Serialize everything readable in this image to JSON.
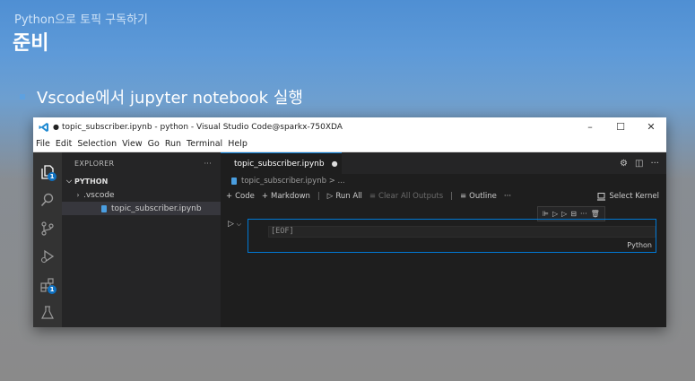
{
  "slide": {
    "subtitle": "Python으로 토픽 구독하기",
    "title": "준비",
    "bullet": "Vscode에서 jupyter notebook 실행"
  },
  "window": {
    "title": "topic_subscriber.ipynb - python - Visual Studio Code@sparkx-750XDA",
    "modified_dot": "●",
    "controls": {
      "minimize": "–",
      "maximize": "☐",
      "close": "✕"
    }
  },
  "menu": [
    "File",
    "Edit",
    "Selection",
    "View",
    "Go",
    "Run",
    "Terminal",
    "Help"
  ],
  "activity_bar": {
    "explorer_badge": "1",
    "extensions_badge": "1",
    "icons": [
      "files-icon",
      "search-icon",
      "source-control-icon",
      "run-debug-icon",
      "extensions-icon",
      "testing-icon"
    ]
  },
  "explorer": {
    "header": "EXPLORER",
    "more": "···",
    "section": "PYTHON",
    "items": [
      {
        "label": ".vscode",
        "type": "folder"
      },
      {
        "label": "topic_subscriber.ipynb",
        "type": "notebook"
      }
    ]
  },
  "editor": {
    "tab": {
      "label": "topic_subscriber.ipynb",
      "dirty": "●"
    },
    "breadcrumb": "topic_subscriber.ipynb > ...",
    "toolbar": {
      "code": "Code",
      "markdown": "Markdown",
      "run_all": "Run All",
      "clear_outputs": "Clear All Outputs",
      "outline": "Outline",
      "more": "···",
      "select_kernel": "Select Kernel"
    },
    "cell": {
      "content": "[EOF]",
      "language": "Python"
    }
  },
  "colors": {
    "accent": "#0078d4",
    "badge": "#0e70c0",
    "bullet": "#5ea1e0"
  }
}
